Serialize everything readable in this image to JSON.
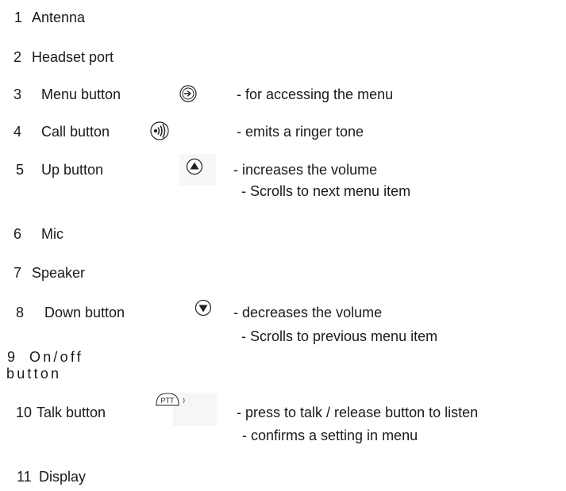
{
  "items": [
    {
      "num": "1",
      "label": "Antenna"
    },
    {
      "num": "2",
      "label": "Headset port"
    },
    {
      "num": "3",
      "label": "Menu button",
      "icon": "menu-arrow-icon",
      "desc": [
        "- for accessing the menu"
      ]
    },
    {
      "num": "4",
      "label": "Call button",
      "icon": "ringer-icon",
      "desc": [
        "- emits a ringer tone"
      ]
    },
    {
      "num": "5",
      "label": "Up button",
      "icon": "up-triangle-icon",
      "desc": [
        "- increases the volume",
        "- Scrolls to next menu item"
      ]
    },
    {
      "num": "6",
      "label": "Mic"
    },
    {
      "num": "7",
      "label": "Speaker"
    },
    {
      "num": "8",
      "label": "Down button",
      "icon": "down-triangle-icon",
      "desc": [
        "- decreases the volume",
        "- Scrolls to previous menu item"
      ]
    },
    {
      "num": "9",
      "label": "On/off",
      "label_cont": "button"
    },
    {
      "num": "10",
      "label": "Talk button",
      "icon": "ptt-icon",
      "icon_text": "PTT",
      "desc": [
        "- press to talk / release button to listen",
        "- confirms a setting in menu"
      ]
    },
    {
      "num": "11",
      "label": "Display"
    }
  ]
}
